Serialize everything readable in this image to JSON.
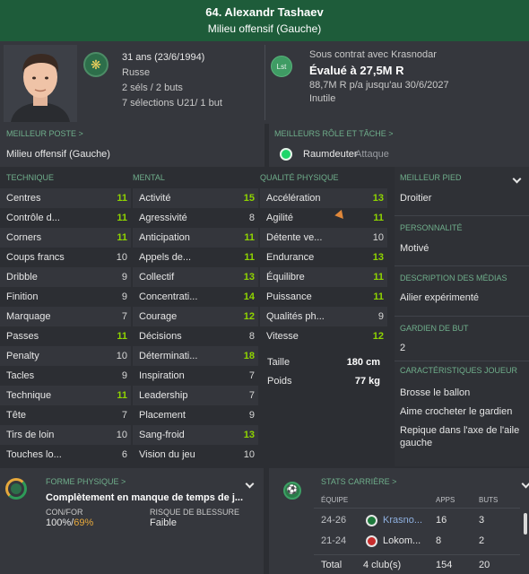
{
  "header": {
    "name": "64. Alexandr Tashaev",
    "position": "Milieu offensif (Gauche)"
  },
  "profile": {
    "age": "31 ans (23/6/1994)",
    "nationality": "Russe",
    "caps": "2 séls / 2 buts",
    "u21": "7 sélections U21/ 1 but",
    "club_badge": "Lst",
    "contract_title": "Sous contrat avec Krasnodar",
    "value": "Évalué à 27,5M R",
    "wage": "88,7M R p/a jusqu'au 30/6/2027",
    "status": "Inutile"
  },
  "best_position": {
    "label": "MEILLEUR POSTE >",
    "value": "Milieu offensif (Gauche)"
  },
  "best_role": {
    "label": "MEILLEURS RÔLE ET TÂCHE >",
    "role": "Raumdeuter",
    "duty": "Attaque"
  },
  "attributes": {
    "technical_label": "TECHNIQUE",
    "mental_label": "MENTAL",
    "physical_label": "QUALITÉ PHYSIQUE",
    "technical": [
      {
        "label": "Centres",
        "value": "11",
        "hi": true
      },
      {
        "label": "Contrôle d...",
        "value": "11",
        "hi": true
      },
      {
        "label": "Corners",
        "value": "11",
        "hi": true
      },
      {
        "label": "Coups francs",
        "value": "10",
        "hi": false
      },
      {
        "label": "Dribble",
        "value": "9",
        "hi": false
      },
      {
        "label": "Finition",
        "value": "9",
        "hi": false
      },
      {
        "label": "Marquage",
        "value": "7",
        "hi": false
      },
      {
        "label": "Passes",
        "value": "11",
        "hi": true
      },
      {
        "label": "Penalty",
        "value": "10",
        "hi": false
      },
      {
        "label": "Tacles",
        "value": "9",
        "hi": false
      },
      {
        "label": "Technique",
        "value": "11",
        "hi": true
      },
      {
        "label": "Tête",
        "value": "7",
        "hi": false
      },
      {
        "label": "Tirs de loin",
        "value": "10",
        "hi": false
      },
      {
        "label": "Touches lo...",
        "value": "6",
        "hi": false
      }
    ],
    "mental": [
      {
        "label": "Activité",
        "value": "15",
        "hi": true
      },
      {
        "label": "Agressivité",
        "value": "8",
        "hi": false
      },
      {
        "label": "Anticipation",
        "value": "11",
        "hi": true
      },
      {
        "label": "Appels de...",
        "value": "11",
        "hi": true
      },
      {
        "label": "Collectif",
        "value": "13",
        "hi": true
      },
      {
        "label": "Concentrati...",
        "value": "14",
        "hi": true
      },
      {
        "label": "Courage",
        "value": "12",
        "hi": true
      },
      {
        "label": "Décisions",
        "value": "8",
        "hi": false
      },
      {
        "label": "Déterminati...",
        "value": "18",
        "hi": true
      },
      {
        "label": "Inspiration",
        "value": "7",
        "hi": false
      },
      {
        "label": "Leadership",
        "value": "7",
        "hi": false
      },
      {
        "label": "Placement",
        "value": "9",
        "hi": false
      },
      {
        "label": "Sang-froid",
        "value": "13",
        "hi": true
      },
      {
        "label": "Vision du jeu",
        "value": "10",
        "hi": false
      }
    ],
    "physical": [
      {
        "label": "Accélération",
        "value": "13",
        "hi": true
      },
      {
        "label": "Agilité",
        "value": "11",
        "hi": true
      },
      {
        "label": "Détente ve...",
        "value": "10",
        "hi": false
      },
      {
        "label": "Endurance",
        "value": "13",
        "hi": true
      },
      {
        "label": "Équilibre",
        "value": "11",
        "hi": true
      },
      {
        "label": "Puissance",
        "value": "11",
        "hi": true
      },
      {
        "label": "Qualités ph...",
        "value": "9",
        "hi": false
      },
      {
        "label": "Vitesse",
        "value": "12",
        "hi": true
      }
    ],
    "height_label": "Taille",
    "height": "180 cm",
    "weight_label": "Poids",
    "weight": "77 kg"
  },
  "side": {
    "foot_label": "MEILLEUR PIED",
    "foot": "Droitier",
    "personality_label": "PERSONNALITÉ",
    "personality": "Motivé",
    "media_label": "DESCRIPTION DES MÉDIAS",
    "media": "Ailier expérimenté",
    "gk_label": "GARDIEN DE BUT",
    "gk": "2",
    "traits_label": "CARACTÉRISTIQUES JOUEUR",
    "traits": [
      "Brosse le ballon",
      "Aime crocheter le gardien",
      "Repique dans l'axe de l'aile gauche"
    ]
  },
  "form": {
    "label": "FORME PHYSIQUE >",
    "status": "Complètement en manque de temps de j...",
    "conf_label": "CON/FOR",
    "conf_a": "100%/",
    "conf_b": "69%",
    "risk_label": "RISQUE DE BLESSURE",
    "risk": "Faible"
  },
  "career": {
    "label": "STATS CARRIÈRE >",
    "col_team": "ÉQUIPE",
    "col_apps": "APPS",
    "col_goals": "BUTS",
    "rows": [
      {
        "years": "24-26",
        "team": "Krasno...",
        "apps": "16",
        "goals": "3"
      },
      {
        "years": "21-24",
        "team": "Lokom...",
        "apps": "8",
        "goals": "2"
      }
    ],
    "total_label": "Total",
    "total_clubs": "4 club(s)",
    "total_apps": "154",
    "total_goals": "20"
  },
  "colors": {
    "accent": "#6fae8b",
    "highlight": "#8fd400",
    "header": "#1e5c3a"
  }
}
